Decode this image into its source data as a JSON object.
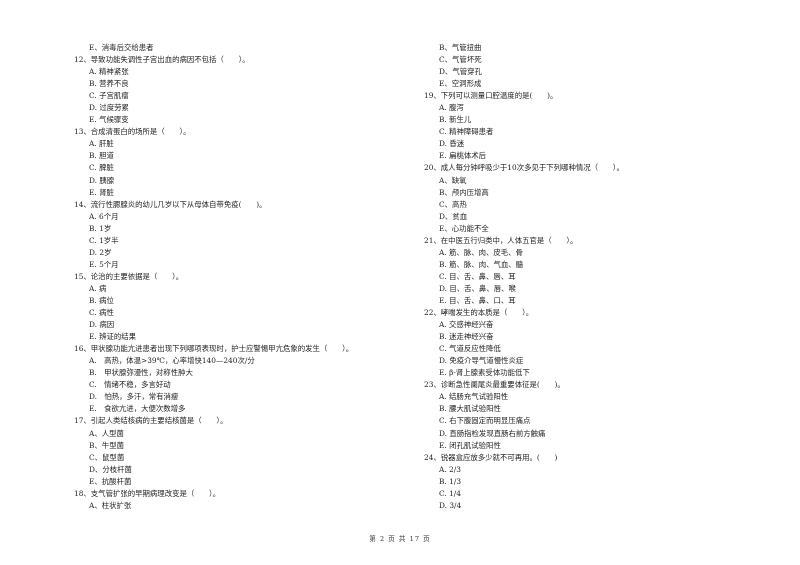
{
  "left_column": [
    {
      "type": "opt",
      "text": "E、消毒后交给患者"
    },
    {
      "type": "q",
      "text": "12、导致功能失调性子宫出血的病因不包括（　　）。"
    },
    {
      "type": "opt",
      "text": "A. 精神紧张"
    },
    {
      "type": "opt",
      "text": "B. 营养不良"
    },
    {
      "type": "opt",
      "text": "C. 子宫肌瘤"
    },
    {
      "type": "opt",
      "text": "D. 过度劳累"
    },
    {
      "type": "opt",
      "text": "E. 气候骤变"
    },
    {
      "type": "q",
      "text": "13、合成清蛋白的场所是（　　）。"
    },
    {
      "type": "opt",
      "text": "A. 肝脏"
    },
    {
      "type": "opt",
      "text": "B. 胆道"
    },
    {
      "type": "opt",
      "text": "C. 脾脏"
    },
    {
      "type": "opt",
      "text": "D. 胰腺"
    },
    {
      "type": "opt",
      "text": "E. 肾脏"
    },
    {
      "type": "q",
      "text": "14、流行性腮腺炎的幼儿几岁以下从母体自带免疫(　　)。"
    },
    {
      "type": "opt",
      "text": "A. 6个月"
    },
    {
      "type": "opt",
      "text": "B. 1岁"
    },
    {
      "type": "opt",
      "text": "C. 1岁半"
    },
    {
      "type": "opt",
      "text": "D. 2岁"
    },
    {
      "type": "opt",
      "text": "E. 5个月"
    },
    {
      "type": "q",
      "text": "15、论治的主要依据是（　　）。"
    },
    {
      "type": "opt",
      "text": "A. 病"
    },
    {
      "type": "opt",
      "text": "B. 病位"
    },
    {
      "type": "opt",
      "text": "C. 病性"
    },
    {
      "type": "opt",
      "text": "D. 病因"
    },
    {
      "type": "opt",
      "text": "E. 辨证的结果"
    },
    {
      "type": "q",
      "text": "16、甲状腺功能亢进患者出现下列哪项表现时，护士应警惕甲亢危象的发生（　　）。"
    },
    {
      "type": "opt",
      "text": "A.　高热，体温>39℃，心率增快140—240次/分"
    },
    {
      "type": "opt",
      "text": "B.　甲状腺弥漫性，对称性肿大"
    },
    {
      "type": "opt",
      "text": "C.　情绪不稳，多言好动"
    },
    {
      "type": "opt",
      "text": "D.　怕热，多汗，常有消瘦"
    },
    {
      "type": "opt",
      "text": "E.　食欲亢进，大便次数增多"
    },
    {
      "type": "q",
      "text": "17、引起人类结核病的主要结核菌是（　　）。"
    },
    {
      "type": "opt",
      "text": "A、人型菌"
    },
    {
      "type": "opt",
      "text": "B、牛型菌"
    },
    {
      "type": "opt",
      "text": "C、鼠型菌"
    },
    {
      "type": "opt",
      "text": "D、分枝杆菌"
    },
    {
      "type": "opt",
      "text": "E、抗酸杆菌"
    },
    {
      "type": "q",
      "text": "18、支气管扩张的早期病理改变是（　　）。"
    },
    {
      "type": "opt",
      "text": "A、柱状扩张"
    }
  ],
  "right_column": [
    {
      "type": "opt",
      "text": "B、气管扭曲"
    },
    {
      "type": "opt",
      "text": "C、气管坏死"
    },
    {
      "type": "opt",
      "text": "D、气管穿孔"
    },
    {
      "type": "opt",
      "text": "E、空洞形成"
    },
    {
      "type": "q",
      "text": "19、下列可以测量口腔温度的是(　　)。"
    },
    {
      "type": "opt",
      "text": "A. 腹泻"
    },
    {
      "type": "opt",
      "text": "B. 新生儿"
    },
    {
      "type": "opt",
      "text": "C. 精神障碍患者"
    },
    {
      "type": "opt",
      "text": "D. 昏迷"
    },
    {
      "type": "opt",
      "text": "E. 扁桃体术后"
    },
    {
      "type": "q",
      "text": "20、成人每分钟呼吸少于10次多见于下列哪种情况（　　）。"
    },
    {
      "type": "opt",
      "text": "A、缺氧"
    },
    {
      "type": "opt",
      "text": "B、颅内压增高"
    },
    {
      "type": "opt",
      "text": "C、高热"
    },
    {
      "type": "opt",
      "text": "D、贫血"
    },
    {
      "type": "opt",
      "text": "E、心功能不全"
    },
    {
      "type": "q",
      "text": "21、在中医五行归类中，人体五官是（　　）。"
    },
    {
      "type": "opt",
      "text": "A. 筋、脉、肉、皮毛、骨"
    },
    {
      "type": "opt",
      "text": "B. 筋、脉、肉、气血、髓"
    },
    {
      "type": "opt",
      "text": "C. 目、舌、鼻、唇、耳"
    },
    {
      "type": "opt",
      "text": "D. 目、舌、鼻、唇、喉"
    },
    {
      "type": "opt",
      "text": "E. 目、舌、鼻、口、耳"
    },
    {
      "type": "q",
      "text": "22、哮喘发生的本质是（　　）。"
    },
    {
      "type": "opt",
      "text": "A. 交感神经兴奋"
    },
    {
      "type": "opt",
      "text": "B. 迷走神经兴奋"
    },
    {
      "type": "opt",
      "text": "C. 气道反应性降低"
    },
    {
      "type": "opt",
      "text": "D. 免疫介导气道慢性炎症"
    },
    {
      "type": "opt",
      "text": "E. β-肾上腺素受体功能低下"
    },
    {
      "type": "q",
      "text": "23、诊断急性阑尾炎最重要体征是(　　)。"
    },
    {
      "type": "opt",
      "text": "A. 结肠充气试验阳性"
    },
    {
      "type": "opt",
      "text": "B. 腰大肌试验阳性"
    },
    {
      "type": "opt",
      "text": "C. 右下腹固定而明显压痛点"
    },
    {
      "type": "opt",
      "text": "D. 直肠指检发现直肠右前方触痛"
    },
    {
      "type": "opt",
      "text": "E. 闭孔肌试验阳性"
    },
    {
      "type": "q",
      "text": "24、锐器盒应放多少就不可再用。(　　)"
    },
    {
      "type": "opt",
      "text": "A. 2/3"
    },
    {
      "type": "opt",
      "text": "B. 1/3"
    },
    {
      "type": "opt",
      "text": "C. 1/4"
    },
    {
      "type": "opt",
      "text": "D. 3/4"
    }
  ],
  "footer": {
    "page_label": "第 2 页 共 17 页"
  }
}
